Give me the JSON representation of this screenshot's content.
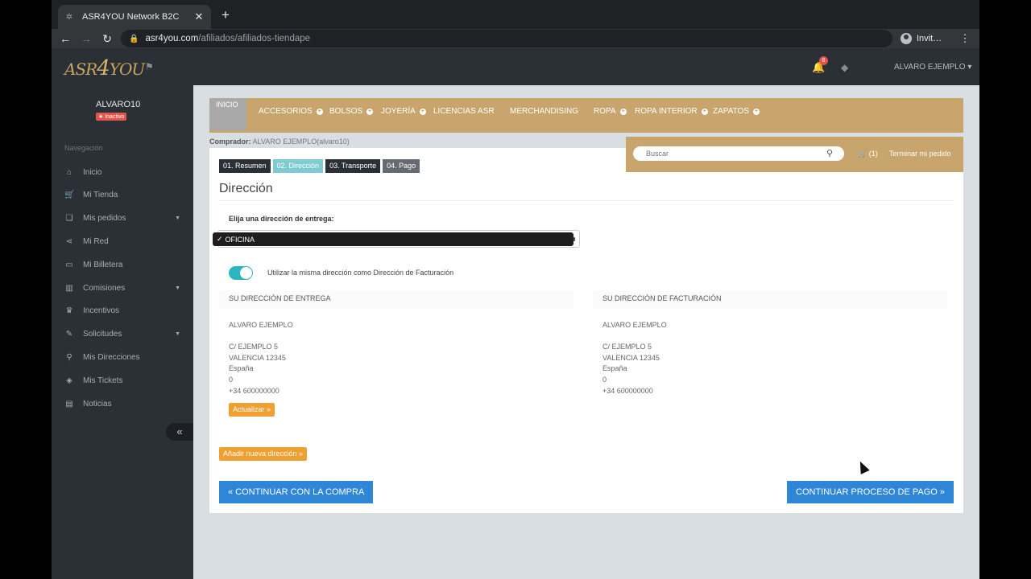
{
  "browser": {
    "tab_title": "ASR4YOU Network B2C",
    "tab_close": "✕",
    "new_tab": "+",
    "url_domain": "asr4you.com",
    "url_path": "/afiliados/afiliados-tiendape",
    "profile_label": "Invit…"
  },
  "header": {
    "logo_left": "ASR",
    "logo_num": "4",
    "logo_right": "YOU",
    "notif_count": "8",
    "user_menu": "ALVARO EJEMPLO ▾"
  },
  "sidebar": {
    "user_name": "ALVARO10",
    "user_status": "★ Inactivo",
    "nav_label": "Navegación",
    "items": [
      {
        "label": "Inicio",
        "icon": "home-icon",
        "glyph": "⌂"
      },
      {
        "label": "Mi Tienda",
        "icon": "cart-icon",
        "glyph": "🛒"
      },
      {
        "label": "Mis pedidos",
        "icon": "orders-icon",
        "glyph": "❏",
        "has_caret": true
      },
      {
        "label": "Mi Red",
        "icon": "share-icon",
        "glyph": "⋖"
      },
      {
        "label": "Mi Billetera",
        "icon": "wallet-icon",
        "glyph": "▭"
      },
      {
        "label": "Comisiones",
        "icon": "chart-icon",
        "glyph": "▥",
        "has_caret": true
      },
      {
        "label": "Incentivos",
        "icon": "trophy-icon",
        "glyph": "♛"
      },
      {
        "label": "Solicitudes",
        "icon": "edit-icon",
        "glyph": "✎",
        "has_caret": true
      },
      {
        "label": "Mis Direcciones",
        "icon": "map-pin-icon",
        "glyph": "⚲"
      },
      {
        "label": "Mis Tickets",
        "icon": "ticket-icon",
        "glyph": "◈"
      },
      {
        "label": "Noticias",
        "icon": "news-icon",
        "glyph": "▤"
      }
    ],
    "collapse": "«"
  },
  "categories": {
    "home": "INICIO",
    "items": [
      "ACCESORIOS",
      "BOLSOS",
      "JOYERÍA",
      "LICENCIAS ASR",
      "MERCHANDISING",
      "ROPA",
      "ROPA INTERIOR",
      "ZAPATOS"
    ]
  },
  "buyer": {
    "label": "Comprador:",
    "value": "ALVARO EJEMPLO(alvaro10)"
  },
  "search": {
    "placeholder": "Buscar",
    "cart": "🛒 (1)",
    "finish": "Terminar mi pedido"
  },
  "steps": [
    "01. Resumen",
    "02. Dirección",
    "03. Transporte",
    "04. Pago"
  ],
  "section_title": "Dirección",
  "choose_label": "Elija una dirección de entrega:",
  "select": {
    "check": "✓",
    "value": "OFICINA"
  },
  "toggle_label": "Utilizar la misma dirección como Dirección de Facturación",
  "shipping": {
    "heading": "SU DIRECCIÓN DE ENTREGA",
    "name": "ALVARO EJEMPLO",
    "street": "C/ EJEMPLO 5",
    "city": "VALENCIA 12345",
    "country": "España",
    "extra": "0",
    "phone": "+34 600000000",
    "update_button": "Actualizar »"
  },
  "billing": {
    "heading": "SU DIRECCIÓN DE FACTURACIÓN",
    "name": "ALVARO EJEMPLO",
    "street": "C/ EJEMPLO 5",
    "city": "VALENCIA 12345",
    "country": "España",
    "extra": "0",
    "phone": "+34 600000000"
  },
  "add_address_button": "Añadir nueva dirección »",
  "continue_shopping": "« CONTINUAR CON LA COMPRA",
  "continue_payment": "CONTINUAR PROCESO DE PAGO »",
  "colors": {
    "gold": "#c8a56c",
    "dark": "#2b2f36",
    "teal": "#2ab5bf",
    "orange": "#f0a030",
    "blue": "#2f86d6"
  }
}
